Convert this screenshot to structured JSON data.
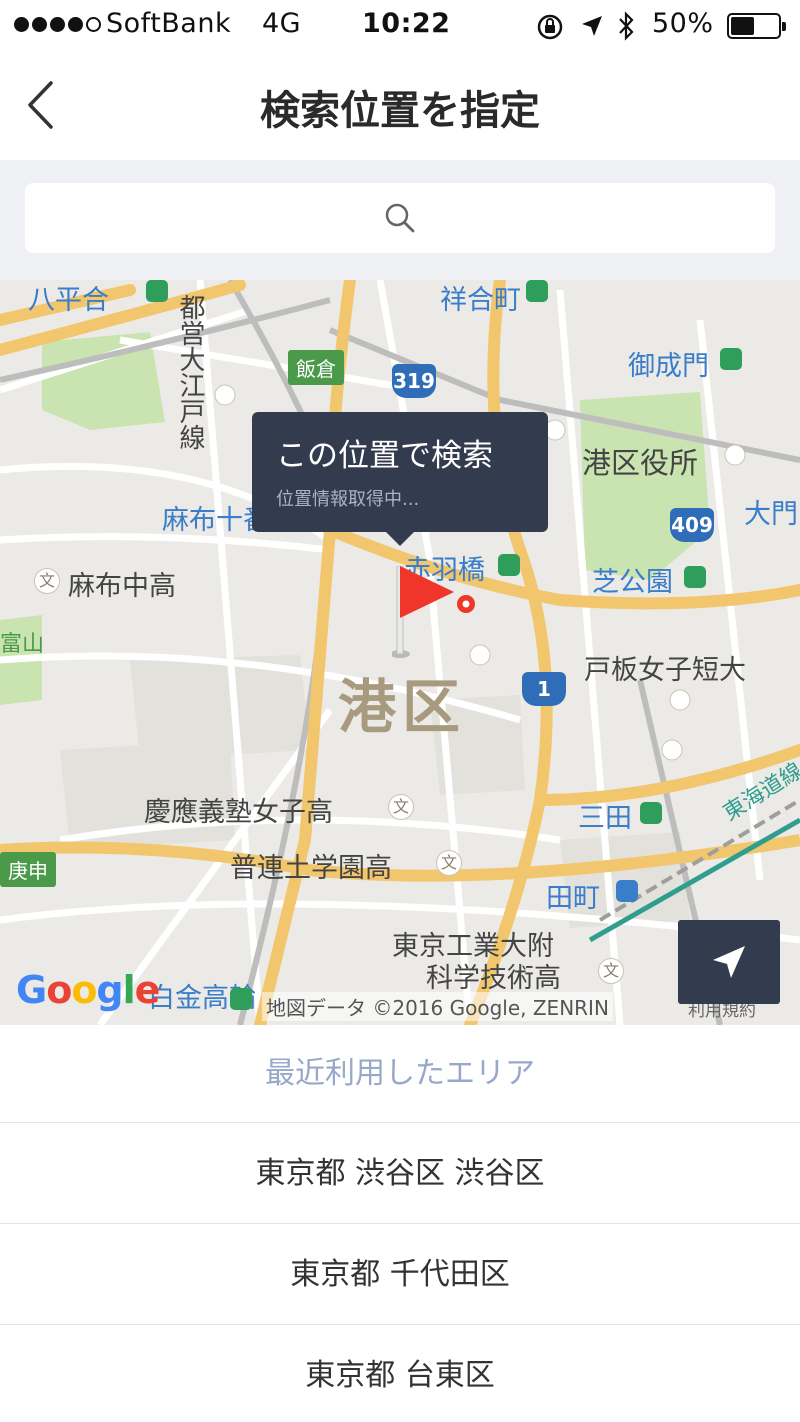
{
  "status_bar": {
    "carrier": "SoftBank",
    "network": "4G",
    "time": "10:22",
    "battery": "50%",
    "battery_level": 0.5,
    "signal_bars": 4,
    "icons": [
      "orientation-lock-icon",
      "location-arrow-icon",
      "bluetooth-icon",
      "battery-icon"
    ]
  },
  "header": {
    "title": "検索位置を指定",
    "back_icon": "chevron-left-icon"
  },
  "search": {
    "placeholder": "",
    "icon": "search-icon"
  },
  "map": {
    "tooltip": {
      "title": "この位置で検索",
      "subtitle": "位置情報取得中..."
    },
    "district": "港区",
    "labels": {
      "hachiman": "八平合",
      "gyouoka": "祥合町",
      "oedo": "都営大江戸線",
      "iikura": "飯倉",
      "route319": "319",
      "onarimon": "御成門",
      "azabujuban": "麻布十番",
      "minato_kuyakusho": "港区役所",
      "route409": "409",
      "daimon": "大門",
      "akabanebashi": "赤羽橋",
      "shibakoen": "芝公園",
      "azabu_chuko": "麻布中高",
      "togita_joshi": "戸板女子短大",
      "route1": "1",
      "keio_joshi": "慶應義塾女子高",
      "mita": "三田",
      "futsurendo": "普連土学園高",
      "shirokane": "白金高輪",
      "tamachi": "田町",
      "tokodai": "東京工業大附",
      "kagaku": "科学技術高",
      "tokaido": "東海道線",
      "koshin": "庚申",
      "tomiyuki": "富山"
    },
    "attribution": "地図データ ©2016 Google, ZENRIN",
    "terms": "利用規約",
    "google_logo": [
      "G",
      "o",
      "o",
      "g",
      "l",
      "e"
    ],
    "locate_icon": "navigation-arrow-icon",
    "flag_icon": "red-flag-icon"
  },
  "recent": {
    "header": "最近利用したエリア",
    "items": [
      {
        "label": "東京都 渋谷区 渋谷区"
      },
      {
        "label": "東京都 千代田区"
      },
      {
        "label": "東京都 台東区"
      }
    ]
  },
  "colors": {
    "dark_panel": "#333b4f",
    "flag": "#f0362b",
    "recent_header": "#98a8c8",
    "search_bg": "#f0f1f4"
  }
}
